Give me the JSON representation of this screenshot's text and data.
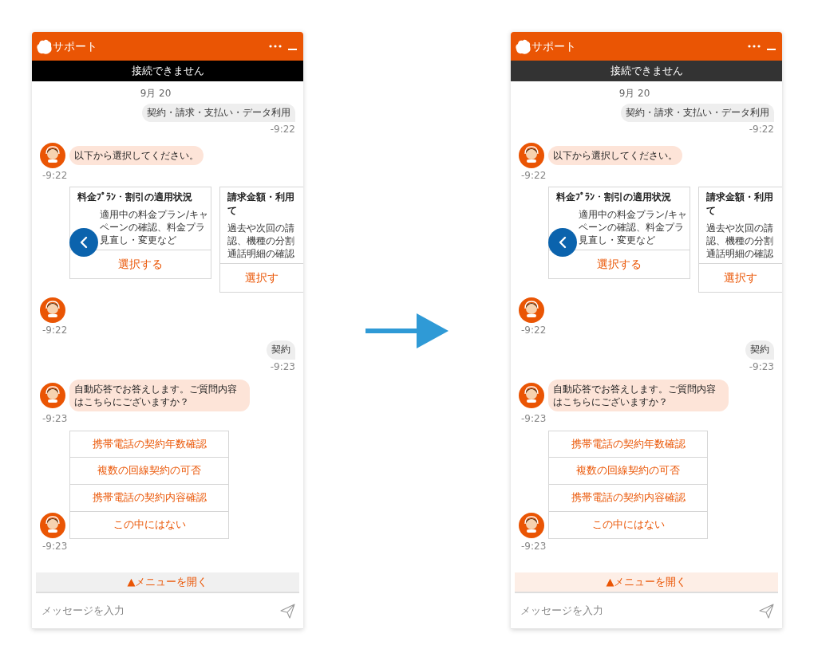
{
  "panels": [
    {
      "header": {
        "title": "サポート"
      },
      "banner": {
        "text": "接続できません",
        "color": "#000000"
      },
      "messages": [
        {
          "kind": "date",
          "text": "9月 20"
        },
        {
          "kind": "user",
          "text": "契約・請求・支払い・データ利用",
          "time": "-9:22"
        },
        {
          "kind": "bot",
          "text": "以下から選択してください。",
          "time": "-9:22"
        },
        {
          "kind": "carousel",
          "cards": [
            {
              "title_lines": [
                "料金ﾌﾟﾗﾝ・割引の適用状況"
              ],
              "body_lines": [
                "適用中の料金プラン/キャ",
                "ペーンの確認、料金プラ",
                "見直し・変更など"
              ],
              "action": "選択する"
            },
            {
              "title_lines": [
                "請求金額・利用",
                "て"
              ],
              "body_lines": [
                "過去や次回の請",
                "認、機種の分割",
                "通話明細の確認"
              ],
              "action": "選択す"
            }
          ],
          "time": "-9:22"
        },
        {
          "kind": "user",
          "text": "契約",
          "time": "-9:23"
        },
        {
          "kind": "bot",
          "text": "自動応答でお答えします。ご質問内容はこちらにございますか？",
          "time": "-9:23"
        },
        {
          "kind": "options",
          "options": [
            "携帯電話の契約年数確認",
            "複数の回線契約の可否",
            "携帯電話の契約内容確認",
            "この中にはない"
          ],
          "time": "-9:23"
        }
      ],
      "menu": {
        "label": "▲メニューを開く",
        "color": "#f0f0f0"
      },
      "input": {
        "placeholder": "メッセージを入力"
      }
    },
    {
      "header": {
        "title": "サポート"
      },
      "banner": {
        "text": "接続できません",
        "color": "#333333"
      },
      "messages": [
        {
          "kind": "date",
          "text": "9月 20"
        },
        {
          "kind": "user",
          "text": "契約・請求・支払い・データ利用",
          "time": "-9:22"
        },
        {
          "kind": "bot",
          "text": "以下から選択してください。",
          "time": "-9:22"
        },
        {
          "kind": "carousel",
          "cards": [
            {
              "title_lines": [
                "料金ﾌﾟﾗﾝ・割引の適用状況"
              ],
              "body_lines": [
                "適用中の料金プラン/キャ",
                "ペーンの確認、料金プラ",
                "見直し・変更など"
              ],
              "action": "選択する"
            },
            {
              "title_lines": [
                "請求金額・利用",
                "て"
              ],
              "body_lines": [
                "過去や次回の請",
                "認、機種の分割",
                "通話明細の確認"
              ],
              "action": "選択す"
            }
          ],
          "time": "-9:22"
        },
        {
          "kind": "user",
          "text": "契約",
          "time": "-9:23"
        },
        {
          "kind": "bot",
          "text": "自動応答でお答えします。ご質問内容はこちらにございますか？",
          "time": "-9:23"
        },
        {
          "kind": "options",
          "options": [
            "携帯電話の契約年数確認",
            "複数の回線契約の可否",
            "携帯電話の契約内容確認",
            "この中にはない"
          ],
          "time": "-9:23"
        }
      ],
      "menu": {
        "label": "▲メニューを開く",
        "color": "#fdeee6"
      },
      "input": {
        "placeholder": "メッセージを入力"
      }
    }
  ]
}
